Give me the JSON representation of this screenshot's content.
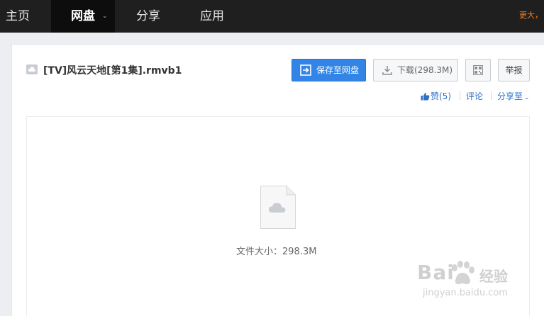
{
  "nav": {
    "home": "主页",
    "disk": "网盘",
    "share": "分享",
    "apps": "应用",
    "more": "更大，"
  },
  "file": {
    "title": "[TV]风云天地[第1集].rmvb1",
    "size_text": "文件大小：298.3M"
  },
  "buttons": {
    "save": "保存至网盘",
    "download": "下载(298.3M)",
    "report": "举报"
  },
  "actions": {
    "like": "赞(5)",
    "comment": "评论",
    "share": "分享至"
  },
  "watermark": {
    "brand_left": "Bai",
    "brand_right": "经验",
    "url": "jingyan.baidu.com"
  },
  "colors": {
    "accent_blue": "#3285e6",
    "nav_bg": "#1f1f1f",
    "link_blue": "#2b6fc7",
    "more_orange": "#ff7f1a"
  }
}
